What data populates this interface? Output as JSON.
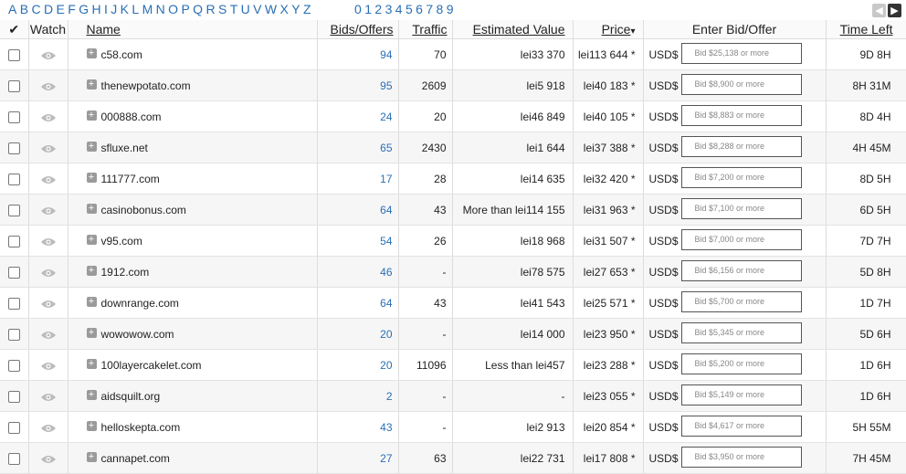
{
  "alphabet": [
    "A",
    "B",
    "C",
    "D",
    "E",
    "F",
    "G",
    "H",
    "I",
    "J",
    "K",
    "L",
    "M",
    "N",
    "O",
    "P",
    "Q",
    "R",
    "S",
    "T",
    "U",
    "V",
    "W",
    "X",
    "Y",
    "Z"
  ],
  "digits": [
    "0",
    "1",
    "2",
    "3",
    "4",
    "5",
    "6",
    "7",
    "8",
    "9"
  ],
  "pager": {
    "prev": "◀",
    "next": "▶"
  },
  "header": {
    "select_all": "✔",
    "watch": "Watch",
    "name": "Name",
    "bids": "Bids/Offers",
    "traffic": "Traffic",
    "estimated_value": "Estimated Value",
    "price": "Price",
    "price_sort": "▾",
    "enter_bid": "Enter Bid/Offer",
    "time_left": "Time Left"
  },
  "rows": [
    {
      "name": "c58.com",
      "bids": "94",
      "traffic": "70",
      "est": "lei33 370",
      "price": "lei113 644 *",
      "currency": "USD$",
      "bid_placeholder": "Bid $25,138 or more",
      "time": "9D 8H"
    },
    {
      "name": "thenewpotato.com",
      "bids": "95",
      "traffic": "2609",
      "est": "lei5 918",
      "price": "lei40 183 *",
      "currency": "USD$",
      "bid_placeholder": "Bid $8,900 or more",
      "time": "8H 31M"
    },
    {
      "name": "000888.com",
      "bids": "24",
      "traffic": "20",
      "est": "lei46 849",
      "price": "lei40 105 *",
      "currency": "USD$",
      "bid_placeholder": "Bid $8,883 or more",
      "time": "8D 4H"
    },
    {
      "name": "sfluxe.net",
      "bids": "65",
      "traffic": "2430",
      "est": "lei1 644",
      "price": "lei37 388 *",
      "currency": "USD$",
      "bid_placeholder": "Bid $8,288 or more",
      "time": "4H 45M"
    },
    {
      "name": "111777.com",
      "bids": "17",
      "traffic": "28",
      "est": "lei14 635",
      "price": "lei32 420 *",
      "currency": "USD$",
      "bid_placeholder": "Bid $7,200 or more",
      "time": "8D 5H"
    },
    {
      "name": "casinobonus.com",
      "bids": "64",
      "traffic": "43",
      "est": "More than lei114 155",
      "price": "lei31 963 *",
      "currency": "USD$",
      "bid_placeholder": "Bid $7,100 or more",
      "time": "6D 5H"
    },
    {
      "name": "v95.com",
      "bids": "54",
      "traffic": "26",
      "est": "lei18 968",
      "price": "lei31 507 *",
      "currency": "USD$",
      "bid_placeholder": "Bid $7,000 or more",
      "time": "7D 7H"
    },
    {
      "name": "1912.com",
      "bids": "46",
      "traffic": "-",
      "est": "lei78 575",
      "price": "lei27 653 *",
      "currency": "USD$",
      "bid_placeholder": "Bid $6,156 or more",
      "time": "5D 8H"
    },
    {
      "name": "downrange.com",
      "bids": "64",
      "traffic": "43",
      "est": "lei41 543",
      "price": "lei25 571 *",
      "currency": "USD$",
      "bid_placeholder": "Bid $5,700 or more",
      "time": "1D 7H"
    },
    {
      "name": "wowowow.com",
      "bids": "20",
      "traffic": "-",
      "est": "lei14 000",
      "price": "lei23 950 *",
      "currency": "USD$",
      "bid_placeholder": "Bid $5,345 or more",
      "time": "5D 6H"
    },
    {
      "name": "100layercakelet.com",
      "bids": "20",
      "traffic": "11096",
      "est": "Less than lei457",
      "price": "lei23 288 *",
      "currency": "USD$",
      "bid_placeholder": "Bid $5,200 or more",
      "time": "1D 6H"
    },
    {
      "name": "aidsquilt.org",
      "bids": "2",
      "traffic": "-",
      "est": "-",
      "price": "lei23 055 *",
      "currency": "USD$",
      "bid_placeholder": "Bid $5,149 or more",
      "time": "1D 6H"
    },
    {
      "name": "helloskepta.com",
      "bids": "43",
      "traffic": "-",
      "est": "lei2 913",
      "price": "lei20 854 *",
      "currency": "USD$",
      "bid_placeholder": "Bid $4,617 or more",
      "time": "5H 55M"
    },
    {
      "name": "cannapet.com",
      "bids": "27",
      "traffic": "63",
      "est": "lei22 731",
      "price": "lei17 808 *",
      "currency": "USD$",
      "bid_placeholder": "Bid $3,950 or more",
      "time": "7H 45M"
    }
  ],
  "colors": {
    "link": "#2a6fb5",
    "row_alt": "#f6f6f6",
    "border": "#dddddd"
  }
}
